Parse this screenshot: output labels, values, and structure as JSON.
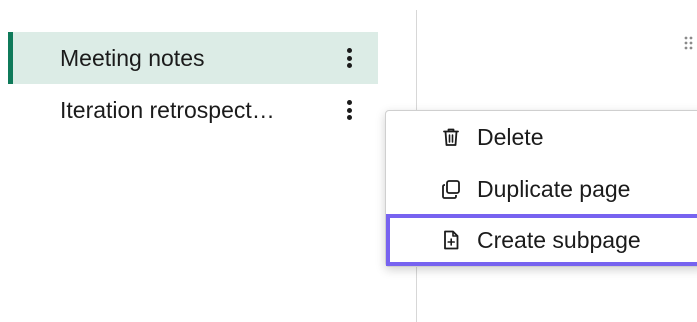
{
  "sidebar": {
    "pages": [
      {
        "label": "Meeting notes",
        "selected": true
      },
      {
        "label": "Iteration retrospect…",
        "selected": false
      }
    ]
  },
  "context_menu": {
    "items": [
      {
        "label": "Delete",
        "icon": "trash-icon"
      },
      {
        "label": "Duplicate page",
        "icon": "duplicate-icon"
      },
      {
        "label": "Create subpage",
        "icon": "add-page-icon",
        "focused": true
      }
    ]
  },
  "colors": {
    "selected_bg": "#dcece6",
    "selected_accent": "#0f7a5a",
    "focus_ring": "#7763f0"
  }
}
